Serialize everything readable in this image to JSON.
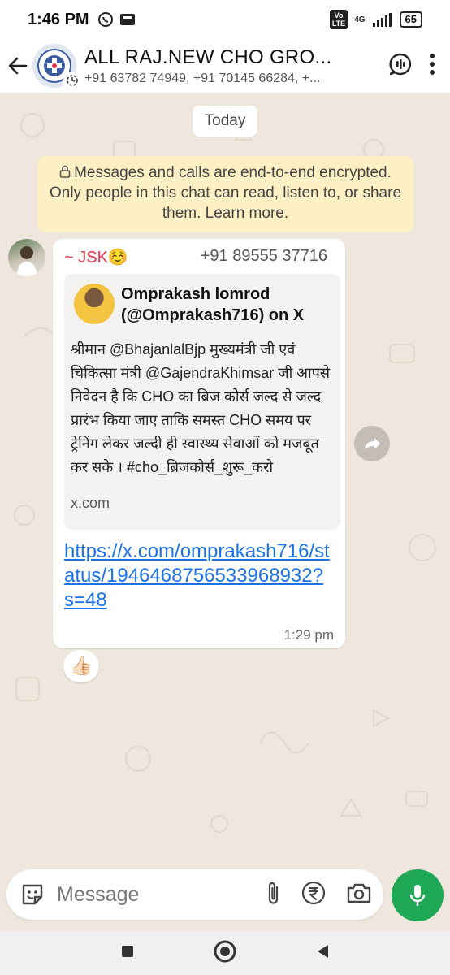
{
  "status_bar": {
    "time": "1:46 PM",
    "network": "4G",
    "volte_label": "Vo\nLTE",
    "battery": "65"
  },
  "header": {
    "title": "ALL RAJ.NEW CHO GRO...",
    "subtitle": "+91 63782 74949, +91 70145 66284, +..."
  },
  "chat": {
    "date_chip": "Today",
    "encryption_notice": "Messages and calls are end-to-end encrypted. Only people in this chat can read, listen to, or share them. Learn more.",
    "message": {
      "sender_name": "~ JSK☺️",
      "sender_phone": "+91 89555 37716",
      "preview_title": "Omprakash lomrod (@Omprakash716) on X",
      "preview_description": "श्रीमान @BhajanlalBjp मुख्यमंत्री जी एवं चिकित्सा मंत्री @GajendraKhimsar जी आपसे निवेदन है कि CHO का ब्रिज कोर्स जल्द से जल्द प्रारंभ किया जाए ताकि समस्त CHO समय पर ट्रेनिंग लेकर जल्दी ही स्वास्थ्य सेवाओं को मजबूत कर सके । #cho_ब्रिजकोर्स_शुरू_करो",
      "preview_domain": "x.com",
      "link_text": "https://x.com/omprakash716/status/1946468756533968932?s=48",
      "time": "1:29 pm",
      "reaction": "👍🏻"
    }
  },
  "composer": {
    "placeholder": "Message"
  },
  "colors": {
    "chat_background": "#efe7dd",
    "sender_name": "#e5344a",
    "link": "#1a73e8",
    "mic_button": "#1fa855",
    "encryption_notice_bg": "#fdf0c4"
  },
  "icons": {
    "back": "arrow-left-icon",
    "call_menu": "audio-chat-icon",
    "more": "more-vertical-icon",
    "emoji": "sticker-smile-icon",
    "attach": "paperclip-icon",
    "payment": "rupee-icon",
    "camera": "camera-icon",
    "mic": "microphone-icon",
    "forward": "forward-arrow-icon",
    "lock": "lock-icon"
  }
}
